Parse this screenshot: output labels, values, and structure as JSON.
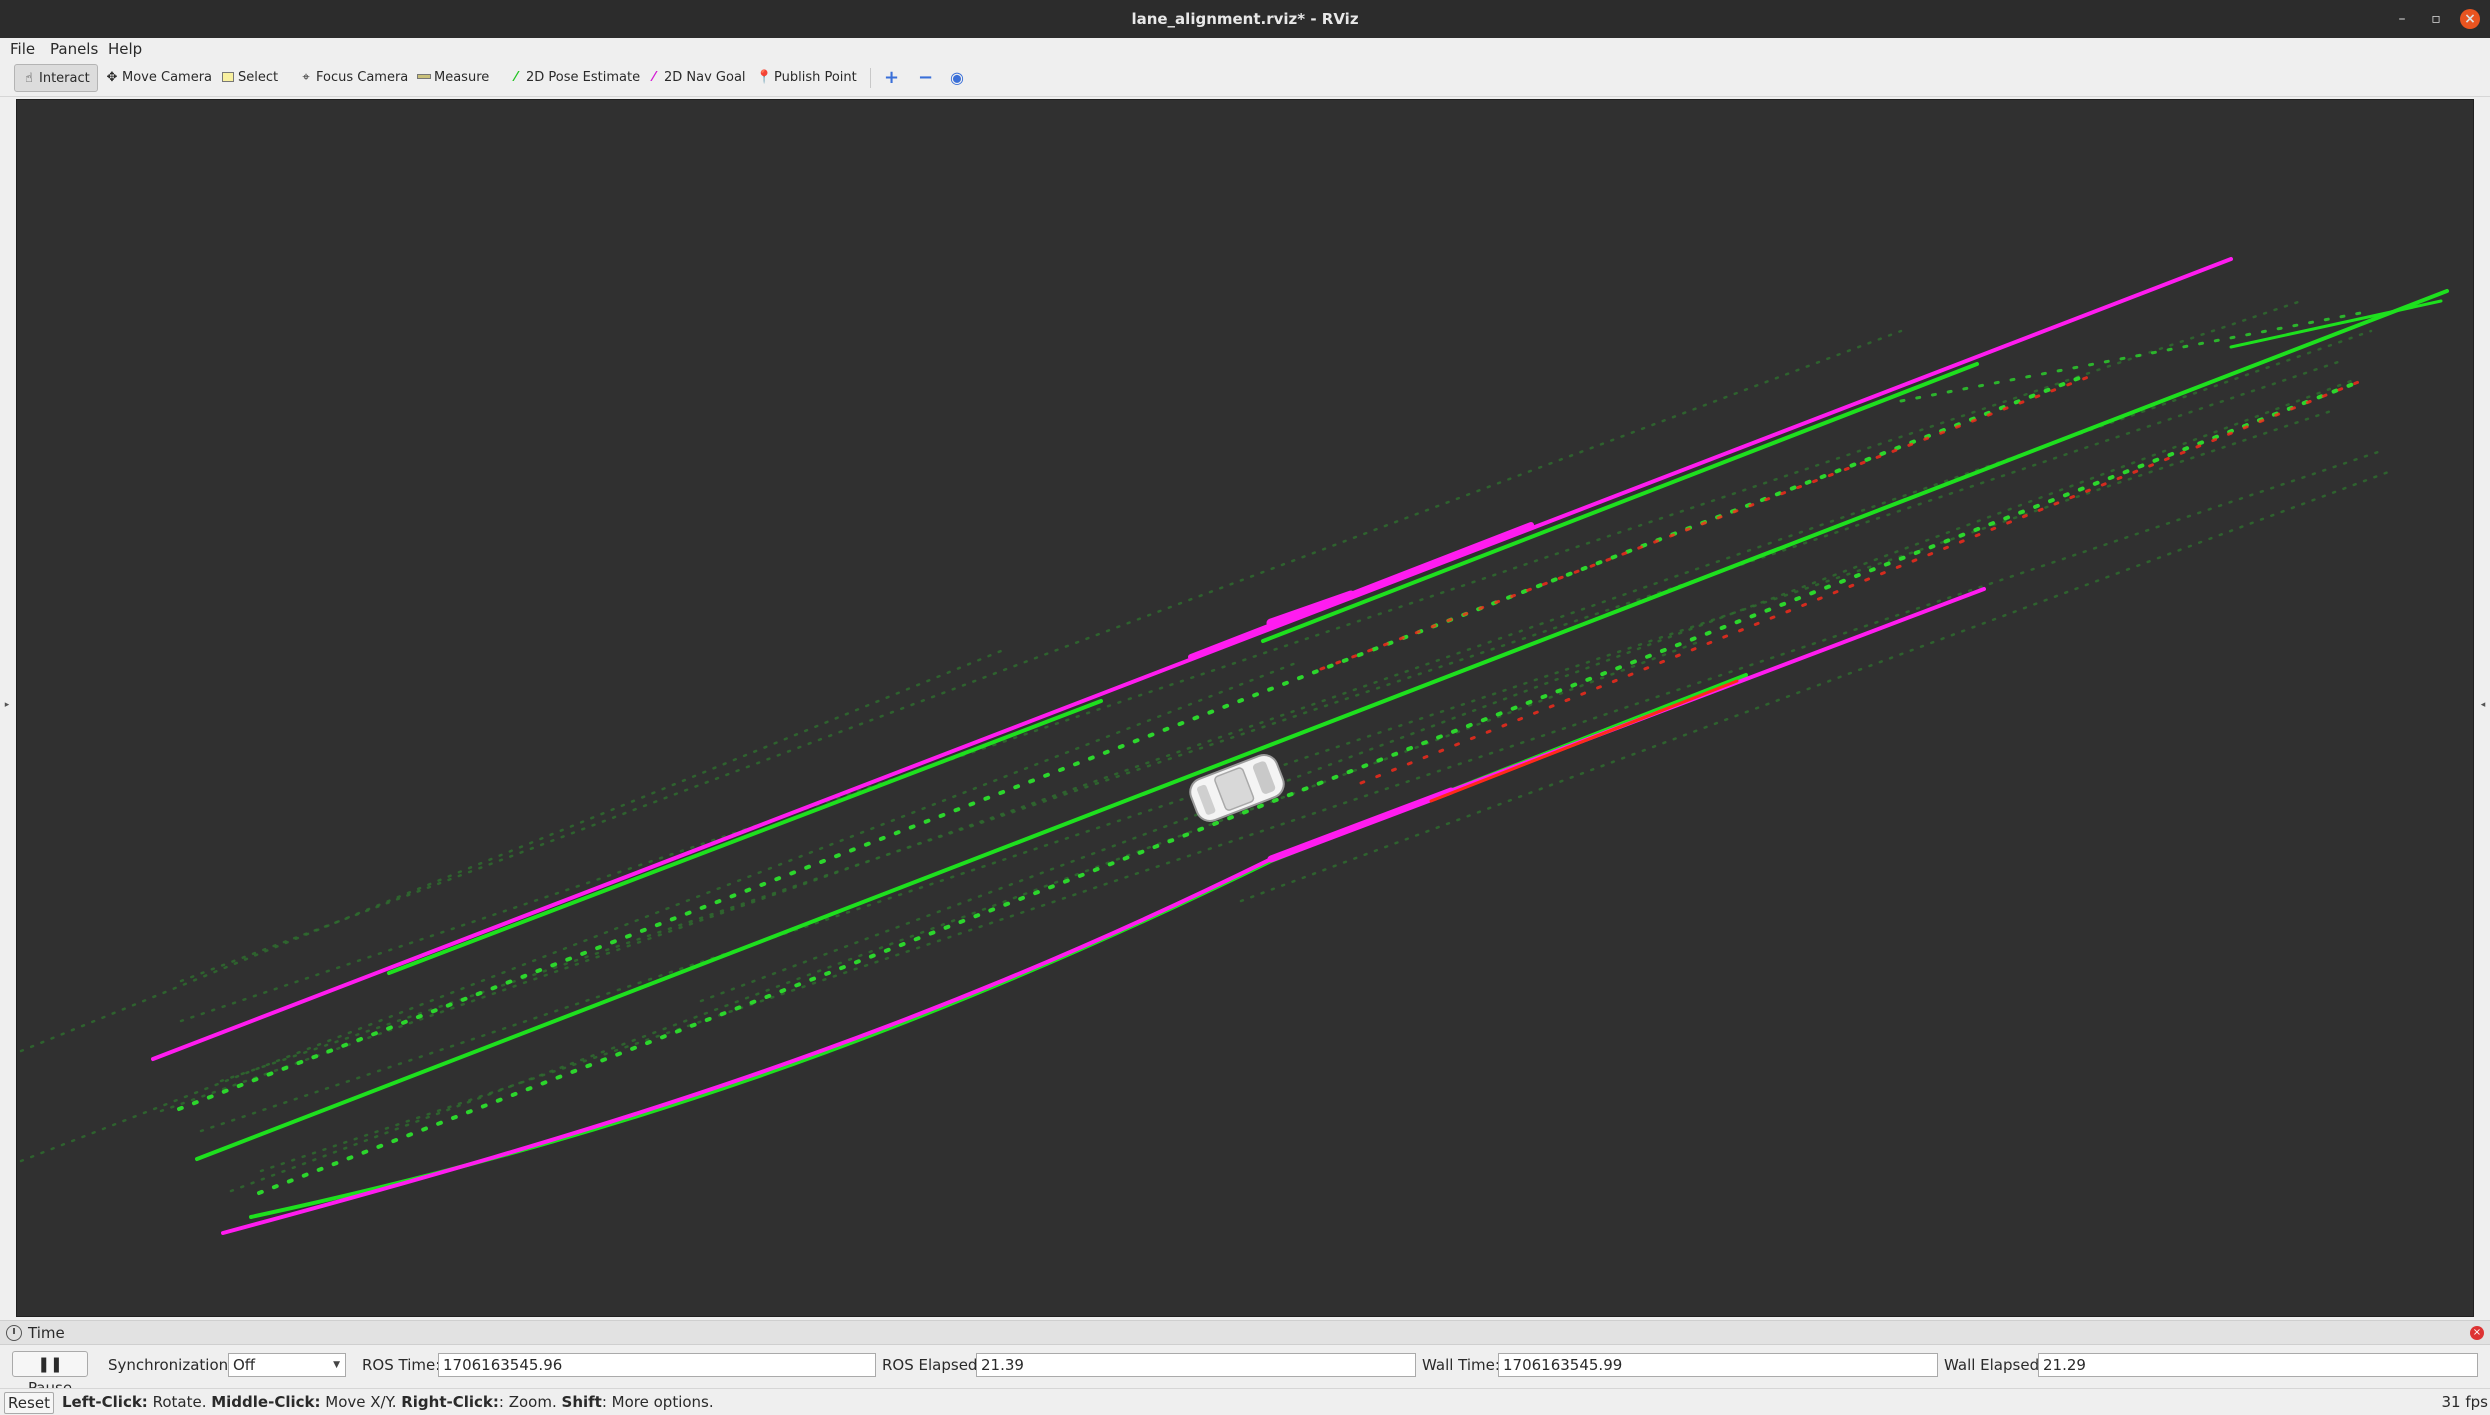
{
  "window": {
    "title": "lane_alignment.rviz* - RViz",
    "min_glyph": "–",
    "max_glyph": "▫",
    "close_glyph": "×"
  },
  "menu": {
    "file": "File",
    "panels": "Panels",
    "help": "Help"
  },
  "toolbar": {
    "interact": "Interact",
    "move_camera": "Move Camera",
    "select": "Select",
    "focus_camera": "Focus Camera",
    "measure": "Measure",
    "pose_estimate": "2D Pose Estimate",
    "nav_goal": "2D Nav Goal",
    "publish_point": "Publish Point",
    "add_glyph": "+",
    "remove_glyph": "−",
    "view_glyph": "◉",
    "icons": {
      "interact": "hand-icon",
      "move_camera": "move-icon",
      "select": "select-icon",
      "focus_camera": "focus-icon",
      "measure": "ruler-icon",
      "pose_estimate": "green-arrow-icon",
      "nav_goal": "magenta-arrow-icon",
      "publish_point": "pin-icon"
    }
  },
  "colors": {
    "viewport_bg": "#303030",
    "boundary": "#ff1cf0",
    "lane": "#1ee01e",
    "lane_dots": "#2cd62c",
    "dim_dots": "#2e6b2e",
    "red": "#ff2a1a",
    "vehicle": "#f2f2f2"
  },
  "time_panel": {
    "title": "Time",
    "pause": "Pause",
    "sync_label": "Synchronization:",
    "sync_value": "Off",
    "ros_time_label": "ROS Time:",
    "ros_time_value": "1706163545.96",
    "ros_elapsed_label": "ROS Elapsed:",
    "ros_elapsed_value": "21.39",
    "wall_time_label": "Wall Time:",
    "wall_time_value": "1706163545.99",
    "wall_elapsed_label": "Wall Elapsed:",
    "wall_elapsed_value": "21.29"
  },
  "status": {
    "reset": "Reset",
    "left_click_key": "Left-Click:",
    "left_click_val": " Rotate. ",
    "middle_click_key": "Middle-Click:",
    "middle_click_val": " Move X/Y. ",
    "right_click_key": "Right-Click:",
    "right_click_val": ": Zoom. ",
    "shift_key": "Shift",
    "shift_val": ": More options.",
    "fps": "31 fps"
  }
}
